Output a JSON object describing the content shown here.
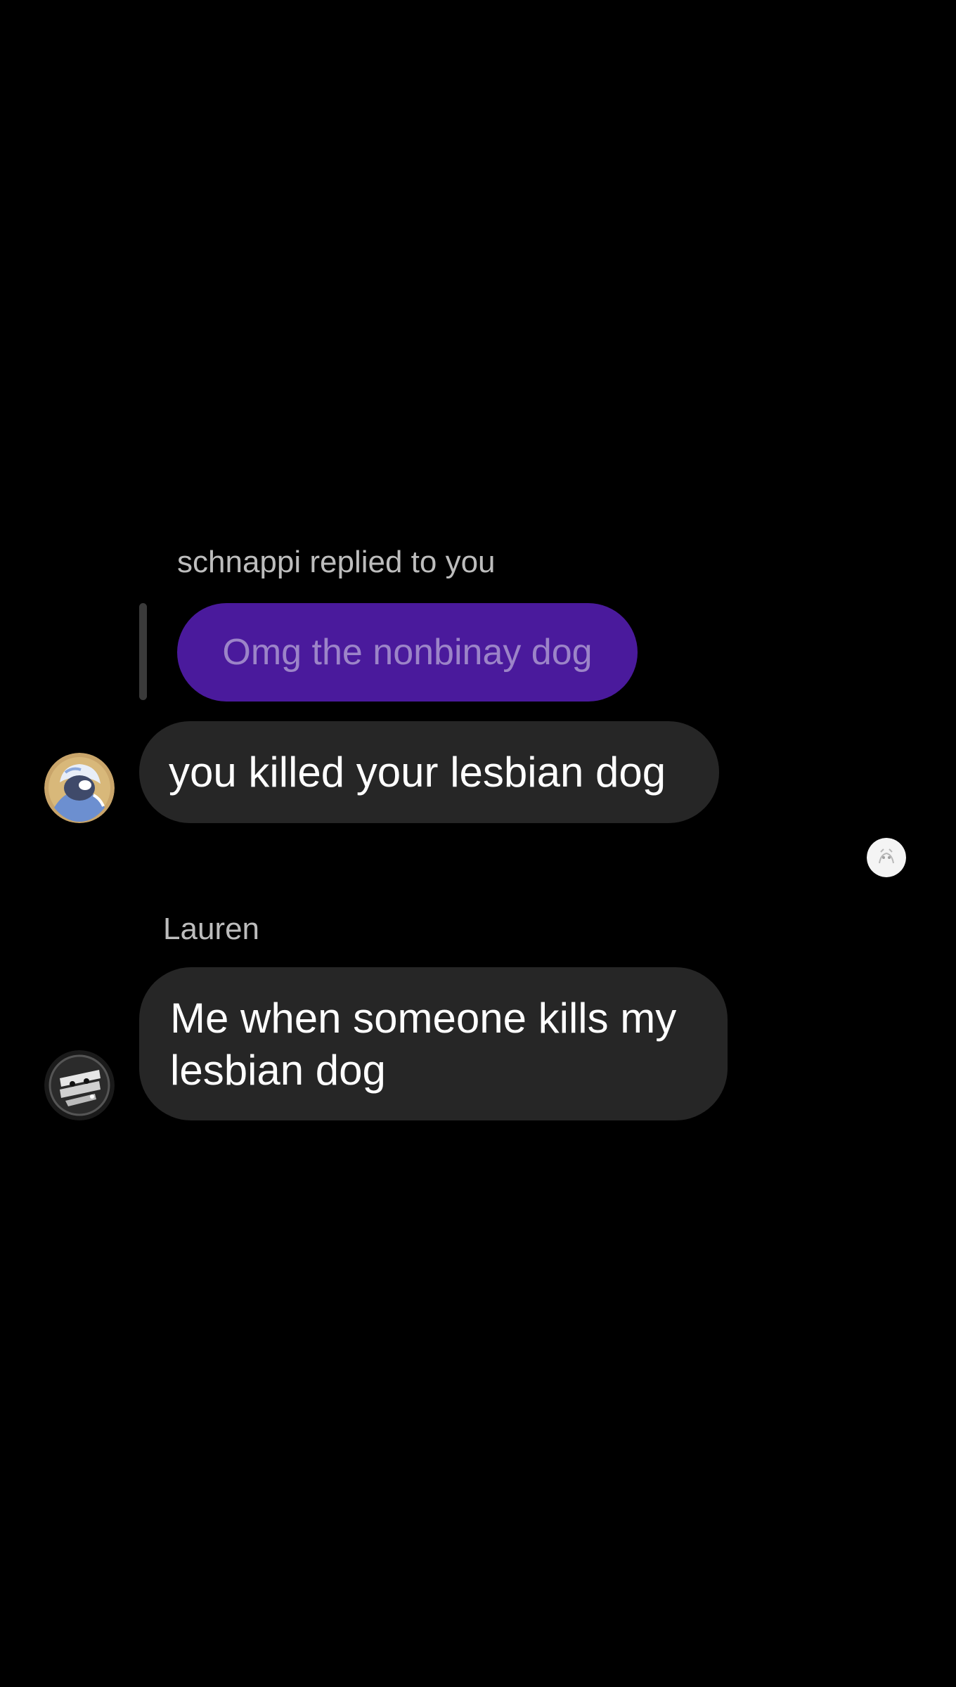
{
  "reply": {
    "caption": "schnappi replied to you",
    "quoted_text": "Omg the nonbinay dog"
  },
  "messages": [
    {
      "text": "you killed your lesbian dog",
      "avatar_icon": "user-avatar-icon"
    },
    {
      "sender": "Lauren",
      "text": "Me when someone kills my lesbian dog",
      "avatar_icon": "user-avatar-icon"
    }
  ],
  "colors": {
    "background": "#000000",
    "incoming_bubble": "#262626",
    "quoted_bubble": "#4a1a9c",
    "quoted_text": "#9c84c8",
    "caption_text": "#bdbdbd"
  }
}
